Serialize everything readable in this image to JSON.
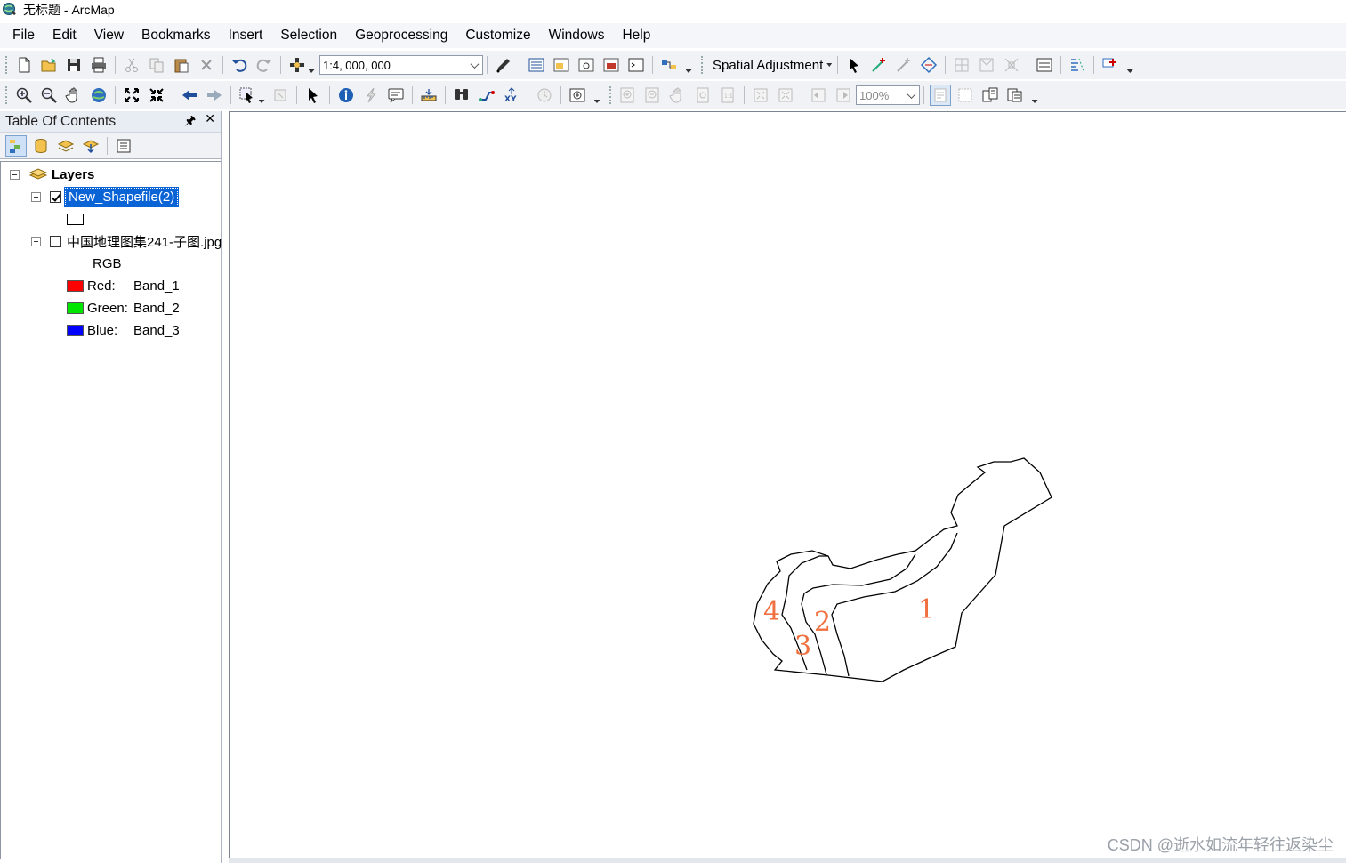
{
  "window": {
    "title": "无标题 - ArcMap",
    "app_icon": "arcmap-globe-icon"
  },
  "menu": [
    "File",
    "Edit",
    "View",
    "Bookmarks",
    "Insert",
    "Selection",
    "Geoprocessing",
    "Customize",
    "Windows",
    "Help"
  ],
  "toolbar": {
    "scale_value": "1:4, 000, 000",
    "spatial_adjustment_label": "Spatial Adjustment",
    "zoom_value": "100%"
  },
  "toc": {
    "title": "Table Of Contents",
    "pin_label": "🖈",
    "close_label": "✕",
    "root_label": "Layers",
    "layers": [
      {
        "name": "New_Shapefile(2)",
        "checked": true,
        "selected": true
      },
      {
        "name": "中国地理图集241-子图.jpg",
        "checked": false,
        "selected": false
      }
    ],
    "rgb_label": "RGB",
    "bands": [
      {
        "channel": "Red:",
        "band": "Band_1",
        "color": "#ff0000"
      },
      {
        "channel": "Green:",
        "band": "Band_2",
        "color": "#00e600"
      },
      {
        "channel": "Blue:",
        "band": "Band_3",
        "color": "#0000ff"
      }
    ]
  },
  "map": {
    "zone_labels": [
      "1",
      "2",
      "3",
      "4"
    ],
    "label_color": "#f07040",
    "line_color": "#000000"
  },
  "watermark": "CSDN @逝水如流年轻往返染尘"
}
